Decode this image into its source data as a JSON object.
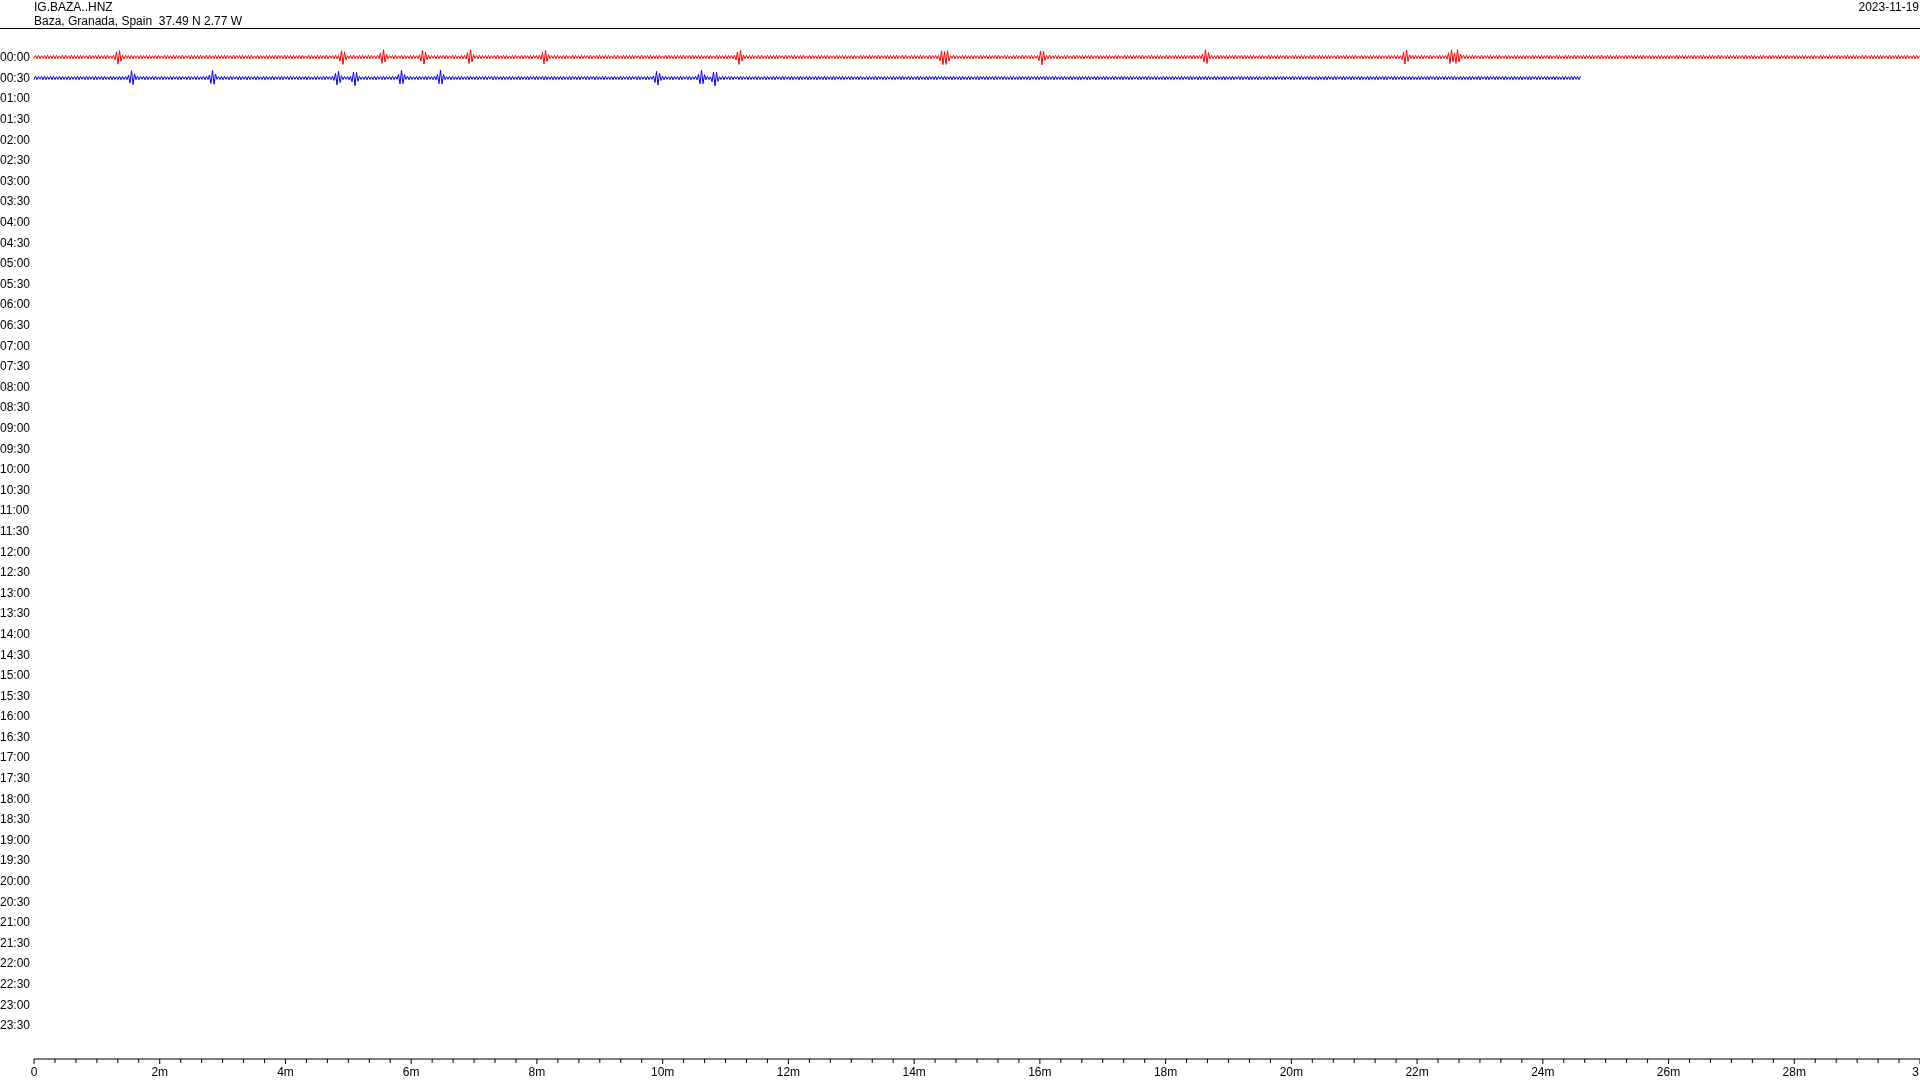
{
  "header": {
    "station": "IG.BAZA..HNZ",
    "location": "Baza, Granada, Spain  37.49 N 2.77 W",
    "date": "2023-11-19"
  },
  "rows": [
    {
      "time": "00:00",
      "trace": {
        "color": "#ff0000",
        "level": 1
      }
    },
    {
      "time": "00:30",
      "trace": {
        "color": "#0000ff",
        "level": 0.82
      }
    },
    {
      "time": "01:00"
    },
    {
      "time": "01:30"
    },
    {
      "time": "02:00"
    },
    {
      "time": "02:30"
    },
    {
      "time": "03:00"
    },
    {
      "time": "03:30"
    },
    {
      "time": "04:00"
    },
    {
      "time": "04:30"
    },
    {
      "time": "05:00"
    },
    {
      "time": "05:30"
    },
    {
      "time": "06:00"
    },
    {
      "time": "06:30"
    },
    {
      "time": "07:00"
    },
    {
      "time": "07:30"
    },
    {
      "time": "08:00"
    },
    {
      "time": "08:30"
    },
    {
      "time": "09:00"
    },
    {
      "time": "09:30"
    },
    {
      "time": "10:00"
    },
    {
      "time": "10:30"
    },
    {
      "time": "11:00"
    },
    {
      "time": "11:30"
    },
    {
      "time": "12:00"
    },
    {
      "time": "12:30"
    },
    {
      "time": "13:00"
    },
    {
      "time": "13:30"
    },
    {
      "time": "14:00"
    },
    {
      "time": "14:30"
    },
    {
      "time": "15:00"
    },
    {
      "time": "15:30"
    },
    {
      "time": "16:00"
    },
    {
      "time": "16:30"
    },
    {
      "time": "17:00"
    },
    {
      "time": "17:30"
    },
    {
      "time": "18:00"
    },
    {
      "time": "18:30"
    },
    {
      "time": "19:00"
    },
    {
      "time": "19:30"
    },
    {
      "time": "20:00"
    },
    {
      "time": "20:30"
    },
    {
      "time": "21:00"
    },
    {
      "time": "21:30"
    },
    {
      "time": "22:00"
    },
    {
      "time": "22:30"
    },
    {
      "time": "23:00"
    },
    {
      "time": "23:30"
    }
  ],
  "x_axis": {
    "labels": [
      "0",
      "2m",
      "4m",
      "6m",
      "8m",
      "10m",
      "12m",
      "14m",
      "16m",
      "18m",
      "20m",
      "22m",
      "24m",
      "26m",
      "28m",
      "3"
    ]
  }
}
